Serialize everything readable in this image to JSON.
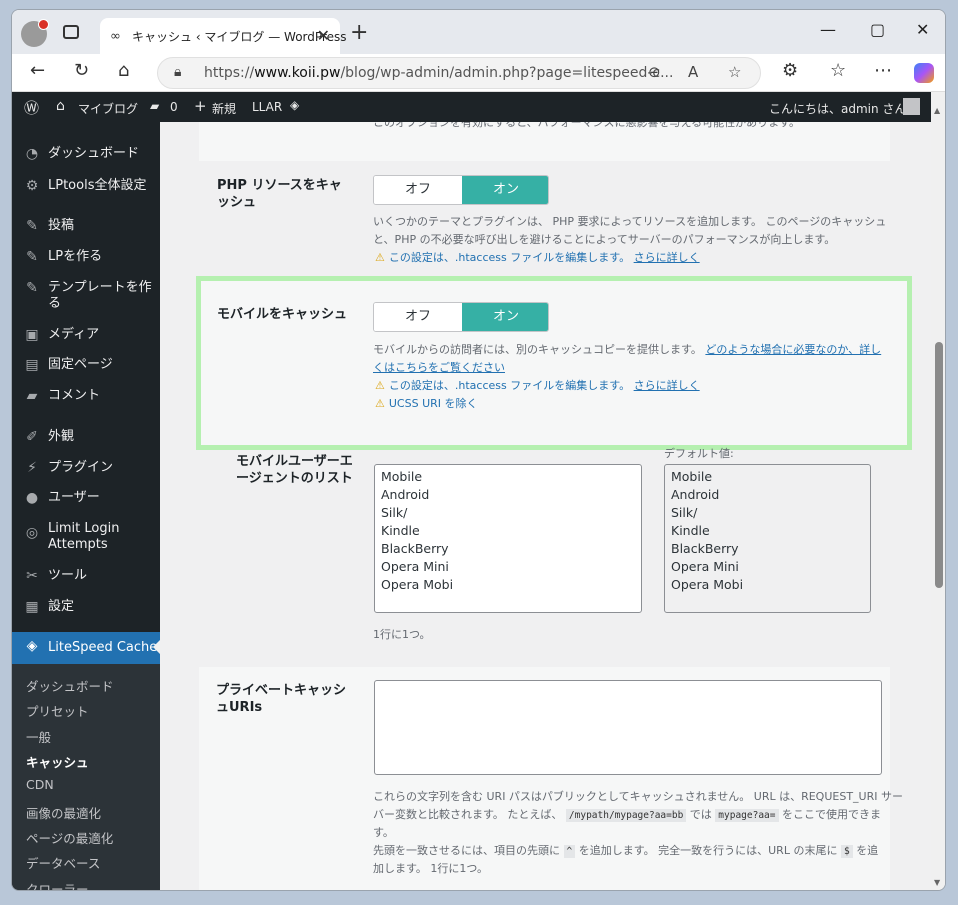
{
  "browser": {
    "tab_title": "キャッシュ ‹ マイブログ — WordPress",
    "url_prefix": "https://",
    "url_domain": "www.koii.pw",
    "url_path": "/blog/wp-admin/admin.php?page=litespeed-c...",
    "win_min": "—",
    "win_max": "▢",
    "win_close": "✕"
  },
  "adminbar": {
    "site_name": "マイブログ",
    "comments_count": "0",
    "new_label": "新規",
    "llar_label": "LLAR",
    "greeting": "こんにちは、admin さん"
  },
  "sidebar": {
    "items": [
      {
        "label": "ダッシュボード",
        "icon": "dashboard-icon"
      },
      {
        "label": "LPtools全体設定",
        "icon": "gear-icon"
      },
      {
        "label": "投稿",
        "icon": "pin-icon"
      },
      {
        "label": "LPを作る",
        "icon": "pin-icon"
      },
      {
        "label": "テンプレートを作る",
        "icon": "pin-icon"
      },
      {
        "label": "メディア",
        "icon": "media-icon"
      },
      {
        "label": "固定ページ",
        "icon": "page-icon"
      },
      {
        "label": "コメント",
        "icon": "comment-icon"
      },
      {
        "label": "外観",
        "icon": "brush-icon"
      },
      {
        "label": "プラグイン",
        "icon": "plugin-icon"
      },
      {
        "label": "ユーザー",
        "icon": "user-icon"
      },
      {
        "label": "Limit Login Attempts",
        "icon": "shield-icon"
      },
      {
        "label": "ツール",
        "icon": "wrench-icon"
      },
      {
        "label": "設定",
        "icon": "settings-icon"
      },
      {
        "label": "LiteSpeed Cache",
        "icon": "litespeed-icon"
      }
    ],
    "submenu": [
      "ダッシュボード",
      "プリセット",
      "一般",
      "キャッシュ",
      "CDN",
      "画像の最適化",
      "ページの最適化",
      "データベース",
      "クローラー"
    ]
  },
  "main": {
    "top_desc": "このオプションを有効にすると、パフォーマンスに悪影響を与える可能性があります。",
    "php_cache": {
      "label": "PHP リソースをキャッシュ",
      "off": "オフ",
      "on": "オン",
      "desc1": "いくつかのテーマとプラグインは、 PHP 要求によってリソースを追加します。 このページのキャッシュ",
      "desc2": "と、PHP の不必要な呼び出しを避けることによってサーバーのパフォーマンスが向上します。",
      "warn": "この設定は、.htaccess ファイルを編集します。",
      "warn_link": "さらに詳しく"
    },
    "mobile_cache": {
      "label": "モバイルをキャッシュ",
      "off": "オフ",
      "on": "オン",
      "desc1": "モバイルからの訪問者には、別のキャッシュコピーを提供します。",
      "desc_link1": "どのような場合に必要なのか、詳し",
      "desc_link2": "くはこちらをご覧ください",
      "warn": "この設定は、.htaccess ファイルを編集します。",
      "warn_link": "さらに詳しく",
      "warn2": "UCSS URI を除く"
    },
    "mobile_ua": {
      "label": "モバイルユーザーエージェントのリスト",
      "default_label": "デフォルト値:",
      "values": "Mobile\nAndroid\nSilk/\nKindle\nBlackBerry\nOpera Mini\nOpera Mobi",
      "default_values": "Mobile\nAndroid\nSilk/\nKindle\nBlackBerry\nOpera Mini\nOpera Mobi",
      "hint": "1行に1つ。"
    },
    "private_uris": {
      "label": "プライベートキャッシュURIs",
      "value": "",
      "desc1": "これらの文字列を含む URI パスはパブリックとしてキャッシュされません。 URL は、REQUEST_URI サー",
      "desc2a": "バー変数と比較されます。 たとえば、",
      "code1": "/mypath/mypage?aa=bb",
      "desc2b": "では",
      "code2": "mypage?aa=",
      "desc2c": "をここで使用できま",
      "desc3": "す。",
      "desc4a": "先頭を一致させるには、項目の先頭に",
      "code3": "^",
      "desc4b": "を追加します。 完全一致を行うには、URL の末尾に",
      "code4": "$",
      "desc4c": "を追",
      "desc5": "加します。 1行に1つ。"
    }
  }
}
